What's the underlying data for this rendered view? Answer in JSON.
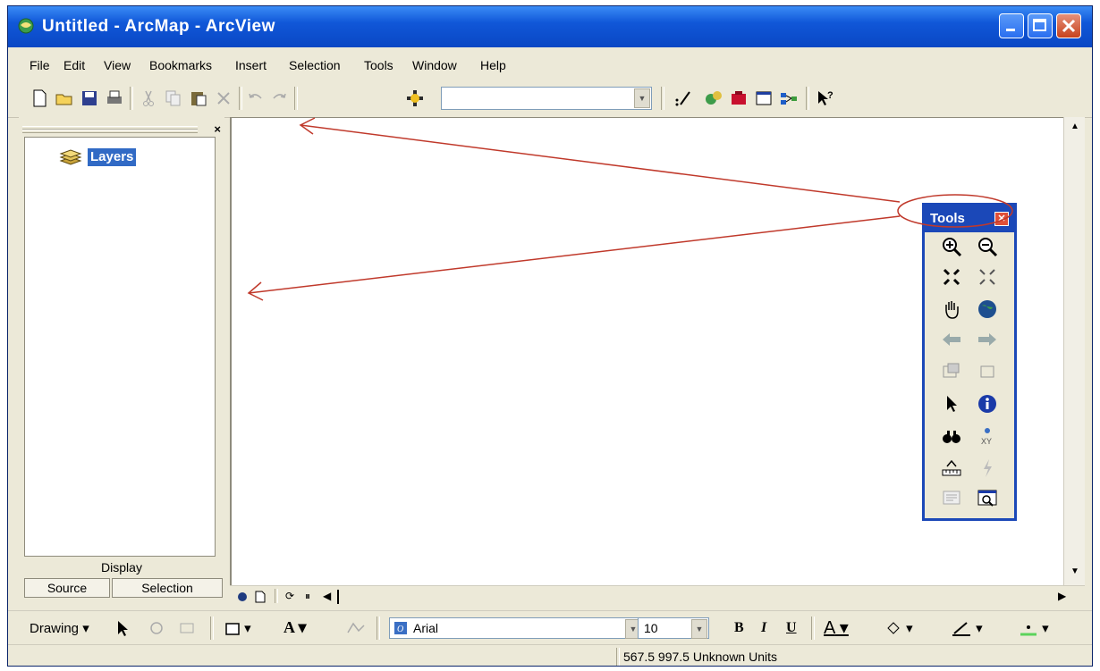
{
  "window": {
    "title": "Untitled - ArcMap - ArcView"
  },
  "menu": {
    "items": [
      "File",
      "Edit",
      "View",
      "Bookmarks",
      "Insert",
      "Selection",
      "Tools",
      "Window",
      "Help"
    ]
  },
  "toc": {
    "root_label": "Layers",
    "tab_display": "Display",
    "tab_source": "Source",
    "tab_selection": "Selection"
  },
  "tools_toolbar": {
    "title": "Tools",
    "icons": [
      "zoom-in-icon",
      "zoom-out-icon",
      "fixed-zoom-in-icon",
      "fixed-zoom-out-icon",
      "pan-icon",
      "full-extent-icon",
      "back-extent-icon",
      "forward-extent-icon",
      "select-features-icon",
      "clear-selection-icon",
      "select-elements-icon",
      "identify-icon",
      "find-icon",
      "go-to-xy-icon",
      "measure-icon",
      "hyperlink-icon",
      "html-popup-icon",
      "create-viewer-icon"
    ]
  },
  "drawing": {
    "label": "Drawing",
    "font_name": "Arial",
    "font_size": "10",
    "bold": "B",
    "italic": "I",
    "underline": "U",
    "text_color_glyph": "A",
    "text_tool_glyph": "A"
  },
  "status": {
    "coordinates": "567.5 997.5 Unknown Units"
  },
  "colors": {
    "title_bar": "#1057d8",
    "selection": "#316ac5",
    "annotation": "#c0392b",
    "tools_border": "#1b48b8"
  }
}
